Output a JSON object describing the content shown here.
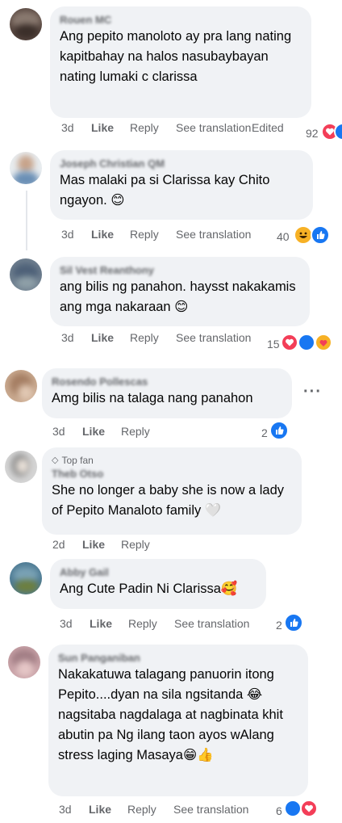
{
  "comments": [
    {
      "name": "Rouen MC",
      "text": "Ang pepito manoloto ay pra lang nating kapitbahay na halos nasubaybayan nating lumaki c clarissa",
      "time": "3d",
      "like": "Like",
      "reply": "Reply",
      "see_translation": "See translation",
      "edited": "Edited",
      "count": "92",
      "reactions": [
        "heart-icon",
        "like-icon"
      ]
    },
    {
      "name": "Joseph Christian QM",
      "text": "Mas malaki pa si Clarissa kay Chito ngayon. 😊",
      "time": "3d",
      "like": "Like",
      "reply": "Reply",
      "see_translation": "See translation",
      "count": "40",
      "reactions": [
        "haha-icon",
        "like-icon"
      ]
    },
    {
      "name": "Sil Vest Reanthony",
      "text": "ang bilis ng panahon. haysst nakakamis ang mga nakaraan 😊",
      "time": "3d",
      "like": "Like",
      "reply": "Reply",
      "see_translation": "See translation",
      "count": "15",
      "reactions": [
        "heart-icon",
        "like-icon",
        "care-icon"
      ]
    },
    {
      "name": "Rosendo Pollescas",
      "text": "Amg bilis na talaga nang panahon",
      "time": "3d",
      "like": "Like",
      "reply": "Reply",
      "count": "2",
      "reactions": [
        "like-icon"
      ],
      "more": "···"
    },
    {
      "badge": "Top fan",
      "name": "Theb Otso",
      "text": "She no longer a baby she is now a lady of Pepito Manaloto family 🤍",
      "time": "2d",
      "like": "Like",
      "reply": "Reply"
    },
    {
      "name": "Abby Gail",
      "text": "Ang Cute Padin Ni Clarissa🥰",
      "time": "3d",
      "like": "Like",
      "reply": "Reply",
      "see_translation": "See translation",
      "count": "2",
      "reactions": [
        "like-icon"
      ]
    },
    {
      "name": "Sun Panganiban",
      "text": "Nakakatuwa talagang panuorin itong Pepito....dyan na sila ngsitanda 😂nagsitaba nagdalaga at nagbinata khit abutin pa Ng ilang taon ayos wAlang stress laging Masaya😁👍",
      "time": "3d",
      "like": "Like",
      "reply": "Reply",
      "see_translation": "See translation",
      "count": "6",
      "reactions": [
        "like-icon",
        "heart-icon"
      ]
    }
  ],
  "colors": {
    "bubble": "#f0f2f5",
    "meta": "#65676b",
    "like": "#1877f2",
    "heart": "#f33e58",
    "haha": "#f7b125"
  }
}
